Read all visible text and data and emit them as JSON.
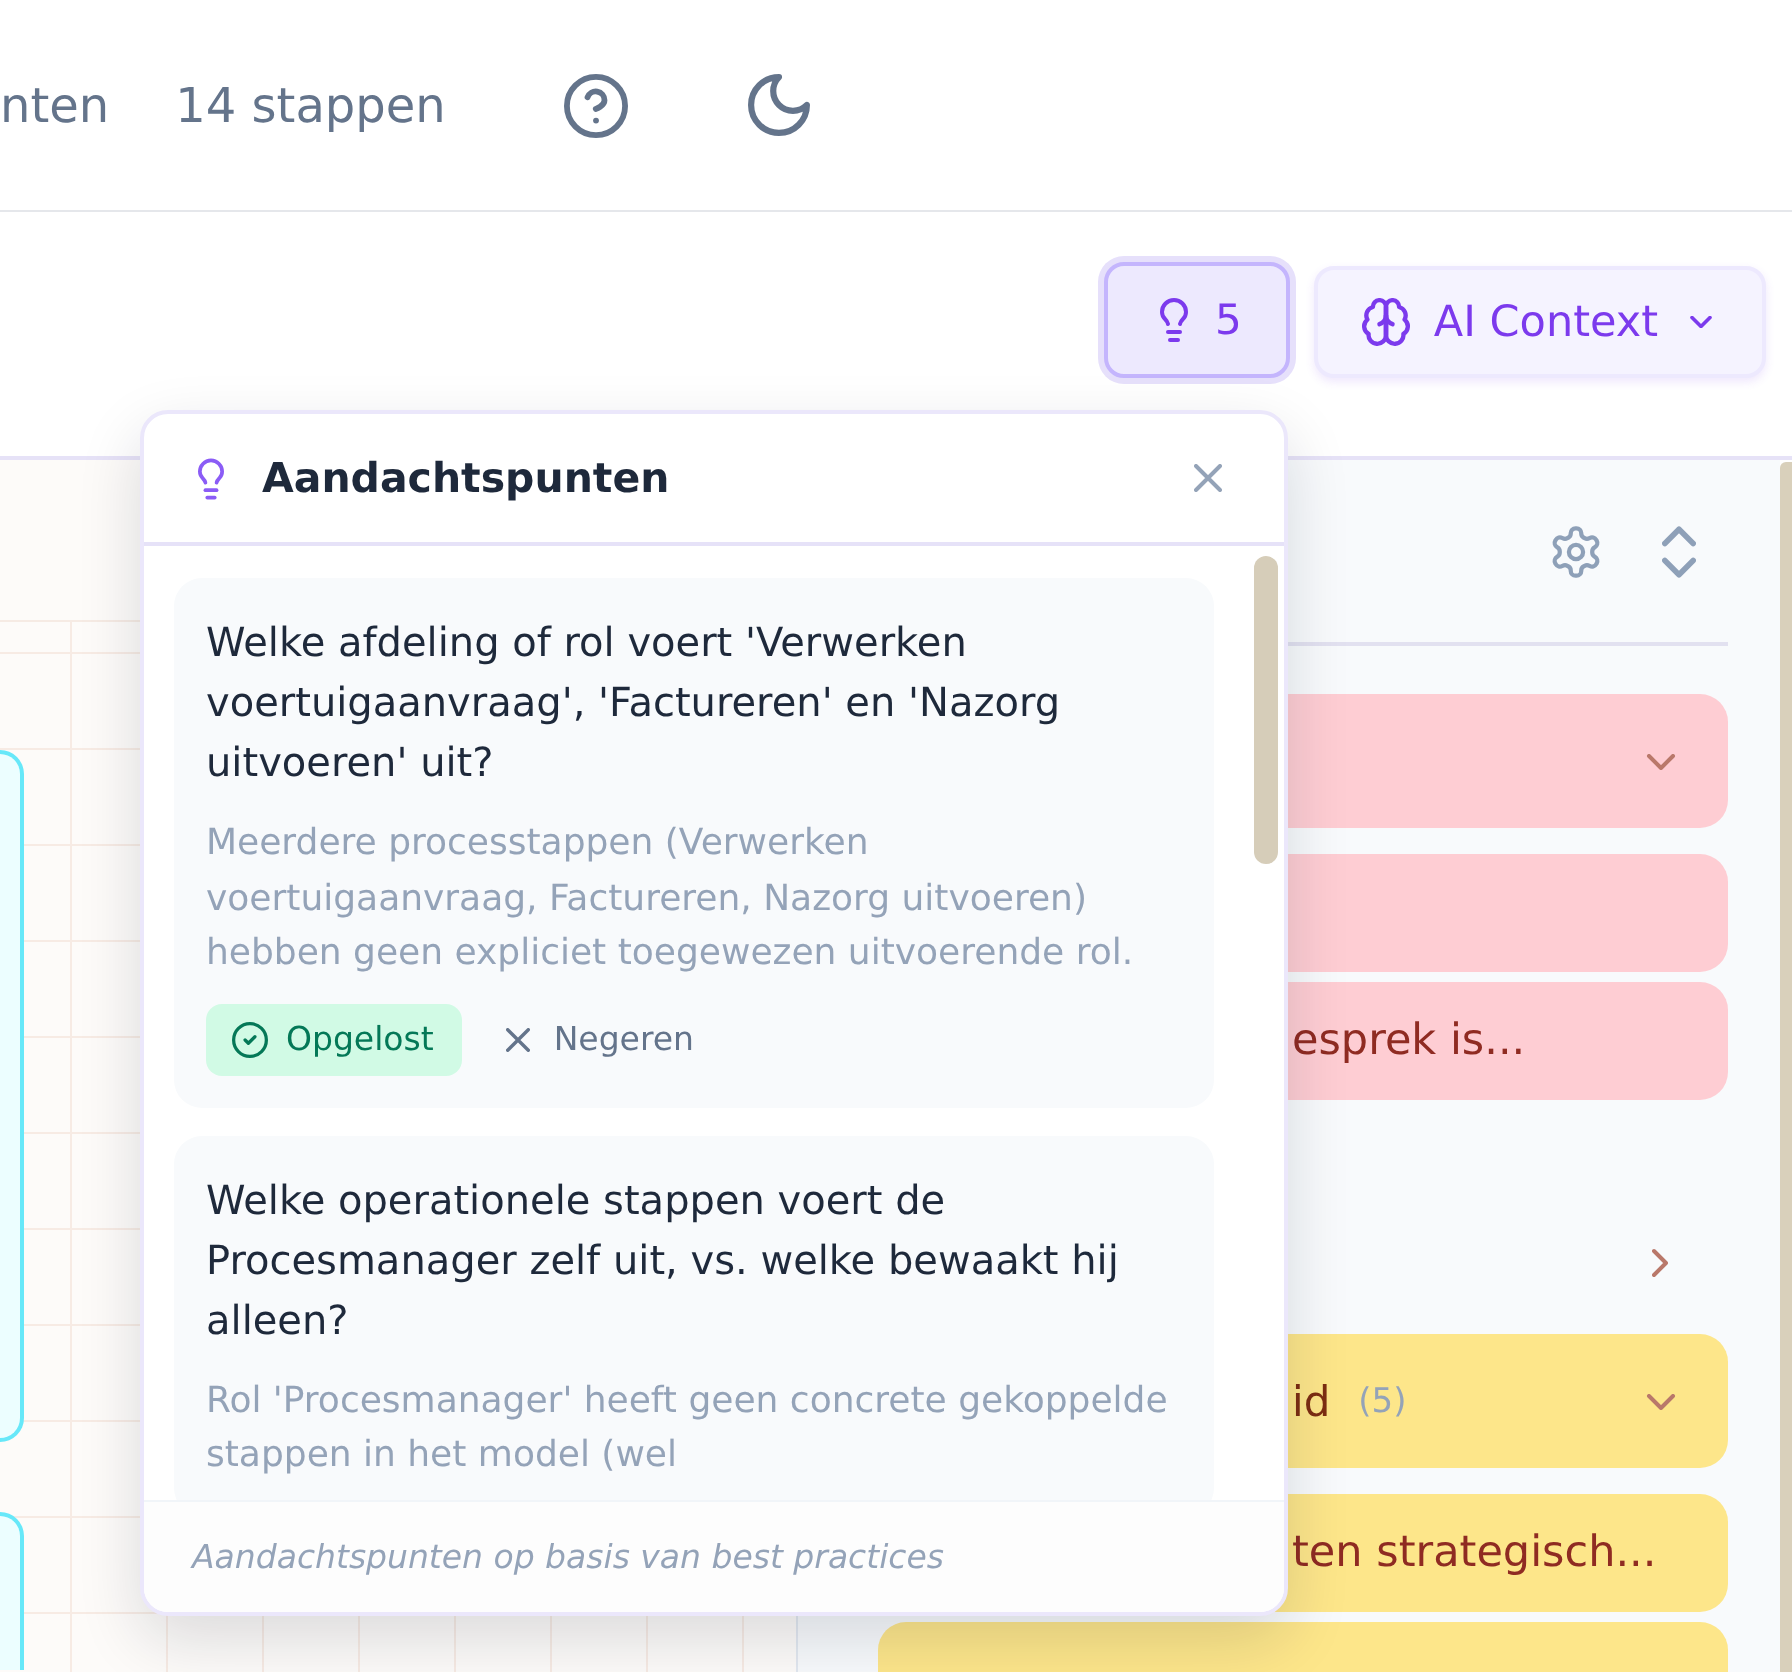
{
  "topbar": {
    "texts": [
      "nten",
      "14 stappen"
    ]
  },
  "toolbar": {
    "hints_button": {
      "count": "5",
      "pressed": true
    },
    "ai_context_button": {
      "label": "AI Context"
    }
  },
  "canvas": {
    "nodes": [
      {
        "kind": "step"
      },
      {
        "kind": "step"
      }
    ]
  },
  "side_panel": {
    "groups": [
      {
        "color": "#fecdd3",
        "expanded": true,
        "entries": [
          {
            "kind": "entry"
          },
          {
            "kind": "entry",
            "text": "esprek is..."
          }
        ]
      },
      {
        "expanded": false
      },
      {
        "color": "#fde68a",
        "expanded": true,
        "label": "id",
        "count": "(5)",
        "entries": [
          {
            "kind": "entry",
            "text": "ten strategisch..."
          },
          {
            "kind": "entry"
          }
        ]
      }
    ]
  },
  "popup": {
    "title": "Aandachtspunten",
    "items": [
      {
        "question": "Welke afdeling of rol voert 'Verwerken voertuigaanvraag', 'Factureren' en 'Nazorg uitvoeren' uit?",
        "description": "Meerdere processtappen (Verwerken voertuigaanvraag, Factureren, Nazorg uitvoeren) hebben geen expliciet toegewezen uitvoerende rol.",
        "actions": [
          {
            "kind": "resolve",
            "label": "Opgelost"
          },
          {
            "kind": "ignore",
            "label": "Negeren"
          }
        ]
      },
      {
        "question": "Welke operationele stappen voert de Procesmanager zelf uit, vs. welke bewaakt hij alleen?",
        "description": "Rol 'Procesmanager' heeft geen concrete gekoppelde stappen in het model (wel"
      }
    ],
    "footer": "Aandachtspunten op basis van best practices"
  }
}
